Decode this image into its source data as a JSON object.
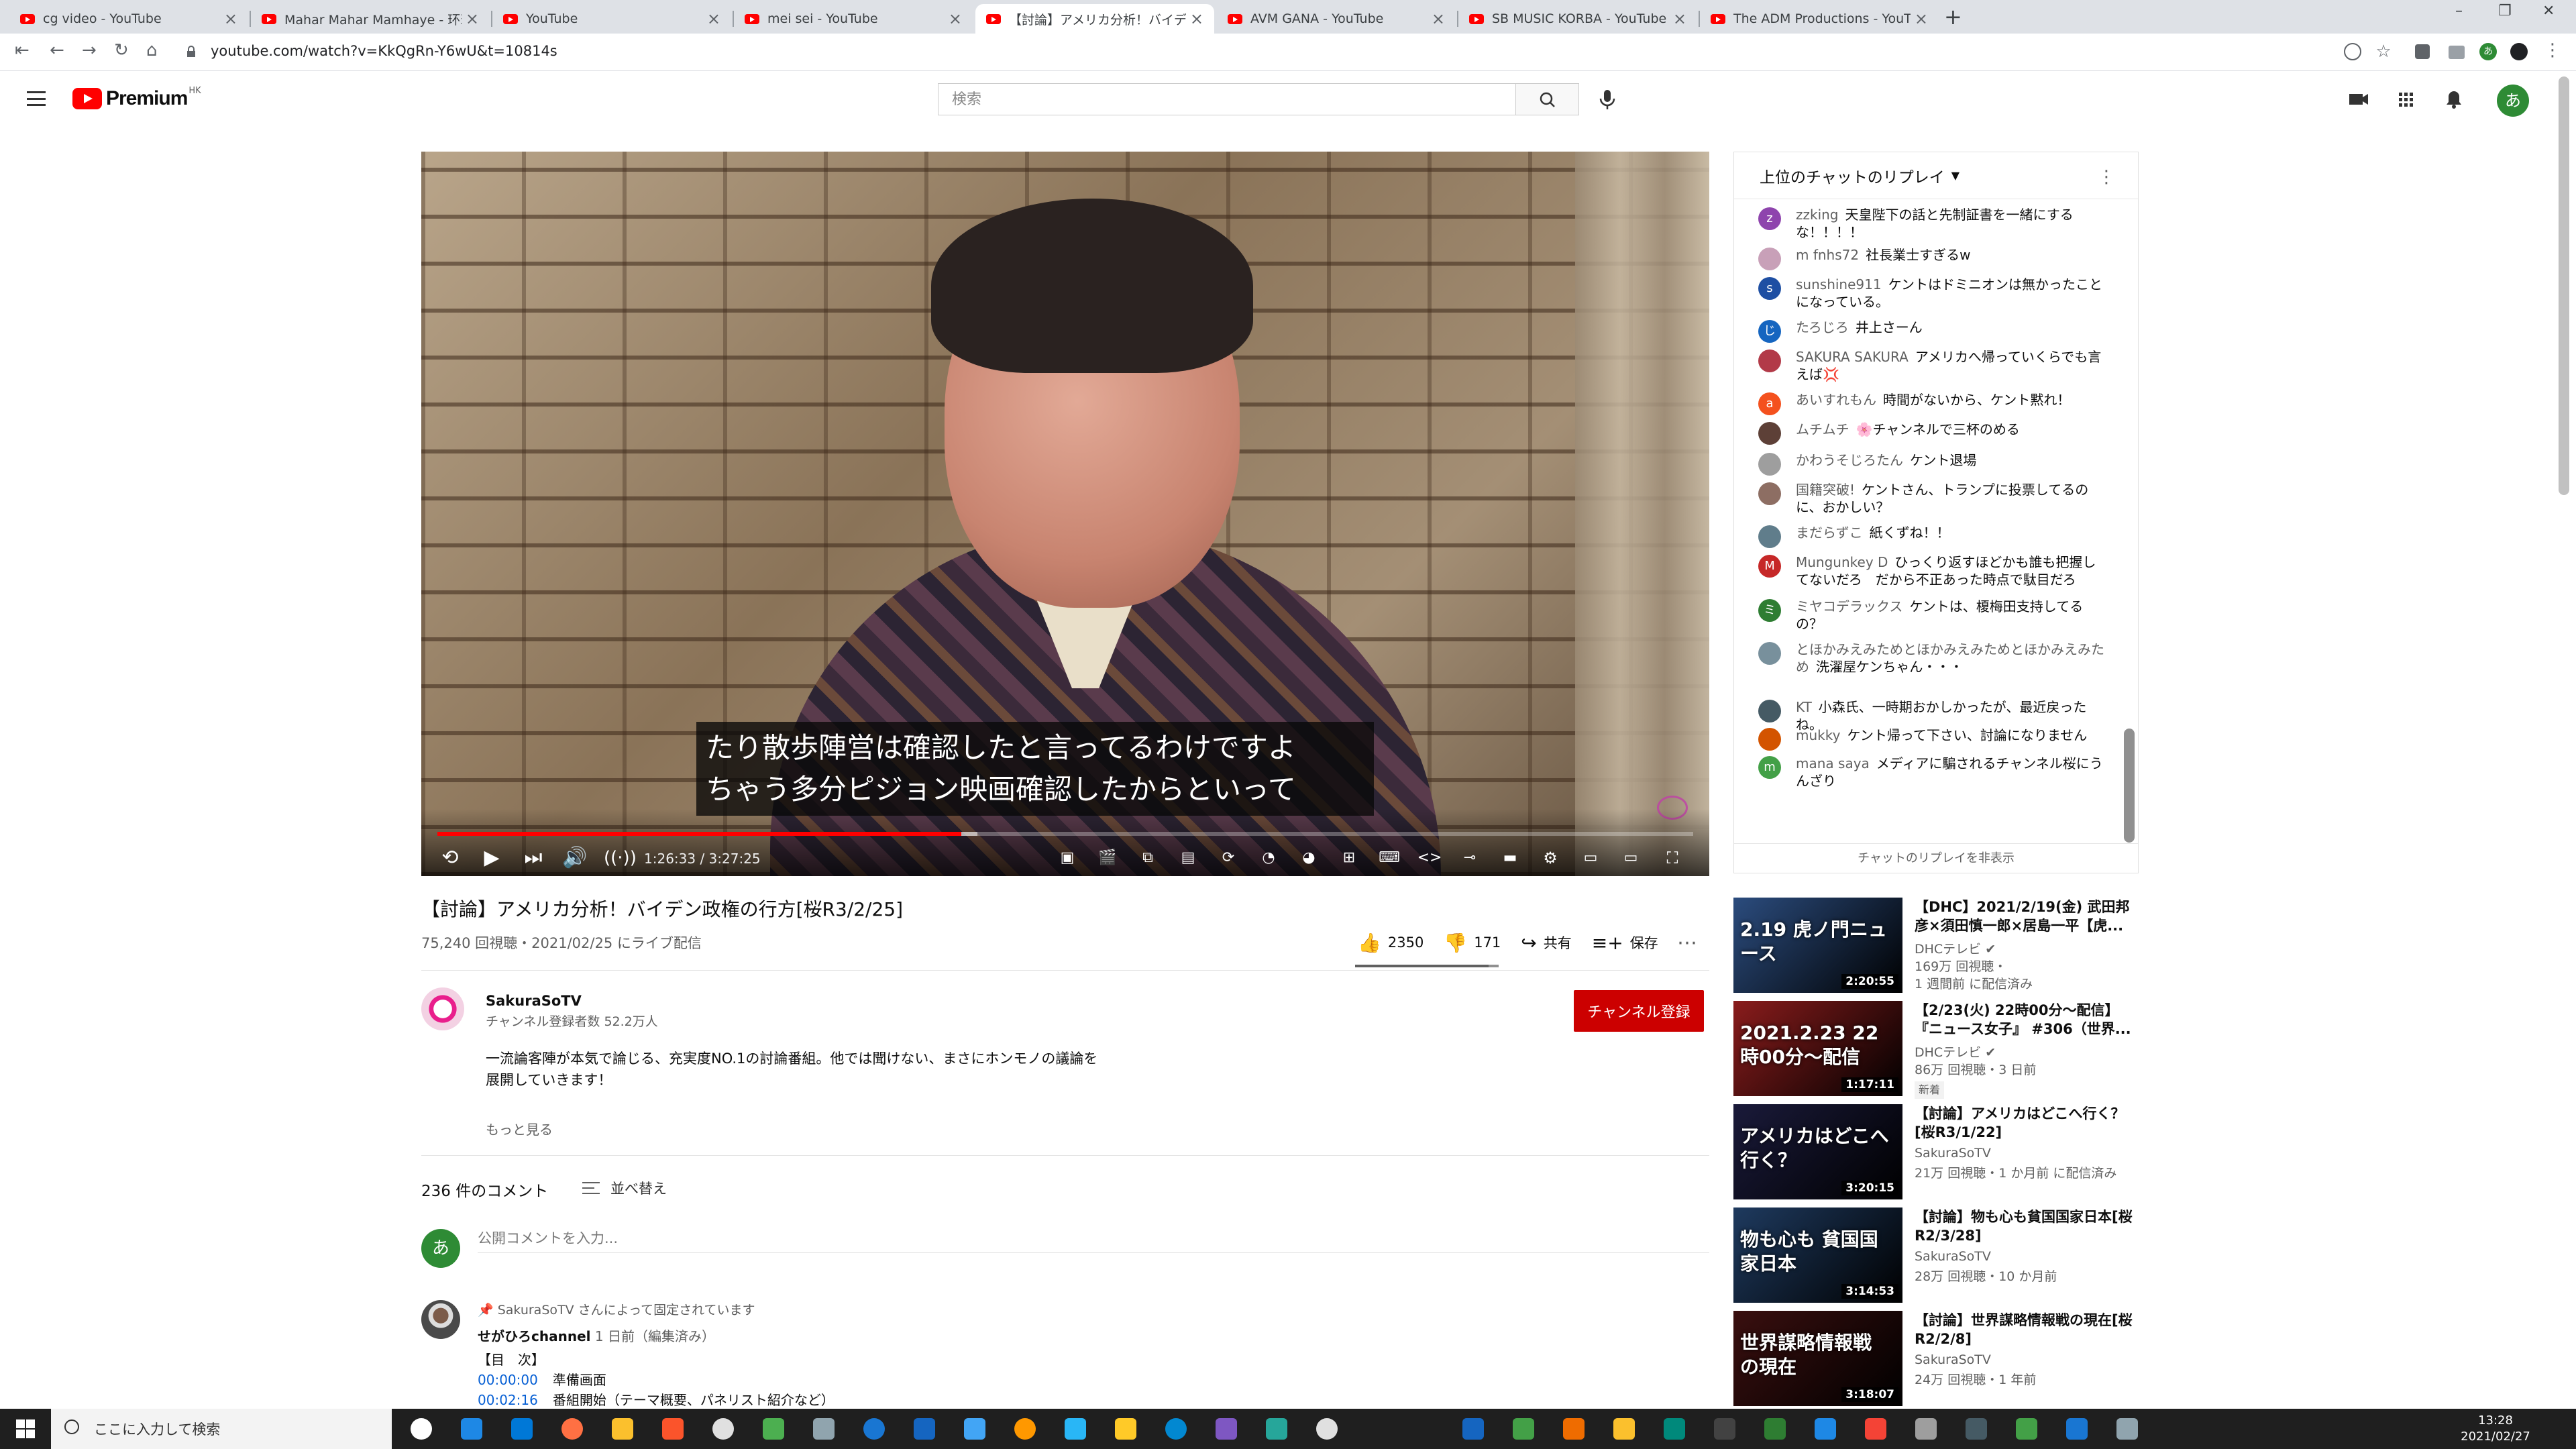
{
  "browser": {
    "tabs": [
      {
        "title": "cg video - YouTube",
        "active": false
      },
      {
        "title": "Mahar Mahar Mamhaye - 环球 ...",
        "active": false
      },
      {
        "title": "YouTube",
        "active": false
      },
      {
        "title": "mei sei - YouTube",
        "active": false
      },
      {
        "title": "【討論】アメリカ分析！バイデン政権...",
        "active": true
      },
      {
        "title": "AVM GANA - YouTube",
        "active": false
      },
      {
        "title": "SB MUSIC KORBA - YouTube",
        "active": false
      },
      {
        "title": "The ADM Productions - YouTube",
        "active": false
      }
    ],
    "url": "youtube.com/watch?v=KkQgRn-Y6wU&t=10814s",
    "profile_initial": "あ"
  },
  "youtube": {
    "logo_text": "Premium",
    "region": "HK",
    "search_placeholder": "検索",
    "avatar_initial": "あ"
  },
  "player": {
    "subtitle_line1": "たり散歩陣営は確認したと言ってるわけですよ",
    "subtitle_line2": "ちゃう多分ピジョン映画確認したからといって",
    "current_time": "1:26:33",
    "duration": "3:27:25",
    "time_display": "1:26:33 / 3:27:25",
    "progress_played": 0.417,
    "progress_buffered": 0.43
  },
  "video": {
    "title": "【討論】アメリカ分析！バイデン政権の行方[桜R3/2/25]",
    "stats": "75,240 回視聴・2021/02/25 にライブ配信",
    "likes": "2350",
    "dislikes": "171",
    "like_ratio": 0.932,
    "share_label": "共有",
    "save_label": "保存"
  },
  "channel": {
    "name": "SakuraSoTV",
    "subscribers": "チャンネル登録者数 52.2万人",
    "subscribe_label": "チャンネル登録",
    "description_line1": "一流論客陣が本気で論じる、充実度NO.1の討論番組。他では聞けない、まさにホンモノの議論を",
    "description_line2": "展開していきます！",
    "show_more": "もっと見る"
  },
  "comments": {
    "count": "236 件のコメント",
    "sort_label": "並べ替え",
    "input_placeholder": "公開コメントを入力...",
    "pinned_label": "SakuraSoTV さんによって固定されています",
    "first": {
      "author": "せがひろchannel",
      "meta": "1 日前（編集済み）",
      "line1": "【目　次】",
      "ts1": "00:00:00",
      "text1": "準備画面",
      "ts2": "00:02:16",
      "text2": "番組開始（テーマ概要、パネリスト紹介など）"
    }
  },
  "chat": {
    "header": "上位のチャットのリプレイ",
    "footer": "チャットのリプレイを非表示",
    "messages": [
      {
        "author": "zzking",
        "text": "天皇陛下の話と先制証書を一緒にするな！！！！",
        "initial": "z",
        "color": "#8e44ad"
      },
      {
        "author": "m fnhs72",
        "text": "社長業士すぎるw",
        "initial": "",
        "color": "#c8a0b8"
      },
      {
        "author": "sunshine911",
        "text": "ケントはドミニオンは無かったことになっている。",
        "initial": "s",
        "color": "#1e4fa3"
      },
      {
        "author": "たろじろ",
        "text": "井上さーん",
        "initial": "じろ",
        "color": "#1565c0"
      },
      {
        "author": "SAKURA SAKURA",
        "text": "アメリカへ帰っていくらでも言えば💢",
        "initial": "",
        "color": "#b23a48"
      },
      {
        "author": "あいすれもん",
        "text": "時間がないから、ケント黙れ！",
        "initial": "a",
        "color": "#f4511e"
      },
      {
        "author": "ムチムチ",
        "text": "🌸チャンネルで三杯のめる",
        "initial": "",
        "color": "#5d4037"
      },
      {
        "author": "かわうそじろたん",
        "text": "ケント退場",
        "initial": "",
        "color": "#9e9e9e"
      },
      {
        "author": "国籍突破!",
        "text": "ケントさん、トランプに投票してるのに、おかしい？",
        "initial": "",
        "color": "#8d6e63"
      },
      {
        "author": "まだらずこ",
        "text": "紙くずね！！",
        "initial": "",
        "color": "#607d8b"
      },
      {
        "author": "Mungunkey D",
        "text": "ひっくり返すほどかも誰も把握してないだろ　だから不正あった時点で駄目だろ",
        "initial": "M",
        "color": "#c62828"
      },
      {
        "author": "ミヤコデラックス",
        "text": "ケントは、榎梅田支持してるの？",
        "initial": "ミ",
        "color": "#2e7d32"
      },
      {
        "author": "とほかみえみためとほかみえみためとほかみえみため",
        "text": "洗濯屋ケンちゃん・・・",
        "initial": "",
        "color": "#78909c"
      },
      {
        "author": "KT",
        "text": "小森氏、一時期おかしかったが、最近戻ったね。",
        "initial": "",
        "color": "#455a64"
      },
      {
        "author": "mukky",
        "text": "ケント帰って下さい、討論になりません",
        "initial": "",
        "color": "#d35400"
      },
      {
        "author": "mana saya",
        "text": "メディアに騙されるチャンネル桜にうんざり",
        "initial": "m",
        "color": "#43a047"
      }
    ]
  },
  "recommendations": [
    {
      "title": "【DHC】2021/2/19(金) 武田邦彦×須田慎一郎×居島一平【虎...",
      "channel": "DHCテレビ",
      "verified": true,
      "views": "169万 回視聴・",
      "meta": "1 週間前 に配信済み",
      "badge": "",
      "duration": "2:20:55",
      "thumb_text": "2.19 虎ノ門ニュース",
      "thumb_bg": "#2b4c7e"
    },
    {
      "title": "【2/23(火) 22時00分～配信】『ニュース女子』 #306（世界...",
      "channel": "DHCテレビ",
      "verified": true,
      "views": "86万 回視聴・3 日前",
      "meta": "",
      "badge": "新着",
      "duration": "1:17:11",
      "thumb_text": "2021.2.23 22時00分～配信",
      "thumb_bg": "#8a1c1c"
    },
    {
      "title": "【討論】アメリカはどこへ行く？[桜R3/1/22]",
      "channel": "SakuraSoTV",
      "verified": false,
      "views": "21万 回視聴・1 か月前 に配信済み",
      "meta": "",
      "badge": "",
      "duration": "3:20:15",
      "thumb_text": "アメリカはどこへ行く？",
      "thumb_bg": "#1a1a3a"
    },
    {
      "title": "【討論】物も心も貧国国家日本[桜R2/3/28]",
      "channel": "SakuraSoTV",
      "verified": false,
      "views": "28万 回視聴・10 か月前",
      "meta": "",
      "badge": "",
      "duration": "3:14:53",
      "thumb_text": "物も心も 貧国国家日本",
      "thumb_bg": "#1e3a5f"
    },
    {
      "title": "【討論】世界謀略情報戦の現在[桜R2/2/8]",
      "channel": "SakuraSoTV",
      "verified": false,
      "views": "24万 回視聴・1 年前",
      "meta": "",
      "badge": "",
      "duration": "3:18:07",
      "thumb_text": "世界謀略情報戦 の現在",
      "thumb_bg": "#3a0f0f"
    }
  ],
  "taskbar": {
    "search_placeholder": "ここに入力して検索",
    "time": "13:28",
    "date": "2021/02/27"
  }
}
